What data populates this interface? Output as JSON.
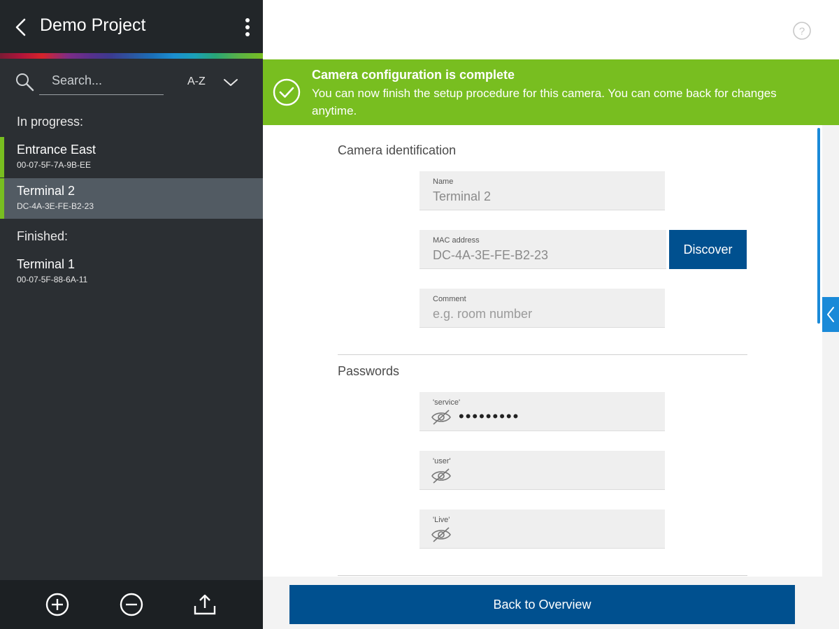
{
  "sidebar": {
    "title": "Demo Project",
    "search": {
      "placeholder": "Search..."
    },
    "sort_label": "A-Z",
    "in_progress_label": "In progress:",
    "finished_label": "Finished:",
    "in_progress": [
      {
        "name": "Entrance East",
        "mac": "00-07-5F-7A-9B-EE"
      },
      {
        "name": "Terminal 2",
        "mac": "DC-4A-3E-FE-B2-23",
        "selected": true
      }
    ],
    "finished": [
      {
        "name": "Terminal 1",
        "mac": "00-07-5F-88-6A-11"
      }
    ],
    "footer_icons": [
      "add-circle-icon",
      "remove-circle-icon",
      "share-upload-icon"
    ]
  },
  "banner": {
    "title": "Camera configuration is complete",
    "text": "You can now finish the setup procedure for this camera. You can come back for changes anytime."
  },
  "identification": {
    "title": "Camera identification",
    "name": {
      "label": "Name",
      "value": "Terminal 2"
    },
    "mac": {
      "label": "MAC address",
      "value": "DC-4A-3E-FE-B2-23"
    },
    "comment": {
      "label": "Comment",
      "placeholder": "e.g. room number"
    },
    "discover_label": "Discover"
  },
  "passwords": {
    "title": "Passwords",
    "service": {
      "label": "'service'",
      "value": "•••••••••"
    },
    "user": {
      "label": "'user'",
      "value": ""
    },
    "live": {
      "label": "'Live'",
      "value": ""
    }
  },
  "back_label": "Back to Overview",
  "colors": {
    "accent_green": "#78be20",
    "brand_blue": "#00508f",
    "sidebar_bg": "#2b2f33",
    "scroll_blue": "#1a8ad8"
  }
}
